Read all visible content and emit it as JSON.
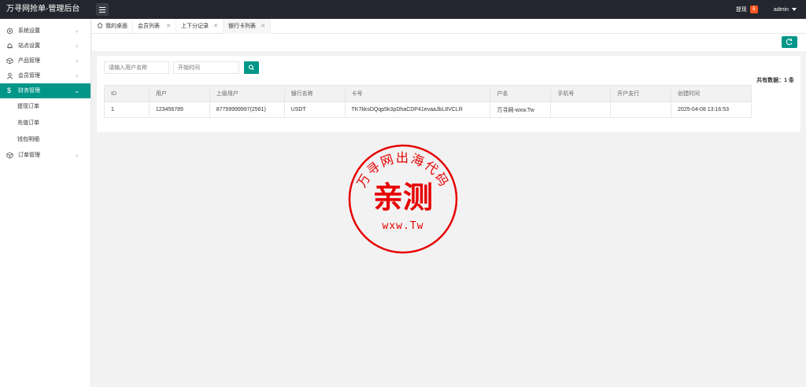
{
  "header": {
    "title": "万寻网抢单-管理后台",
    "withdraw_label": "提现",
    "withdraw_count": "6",
    "user": "admin"
  },
  "sidebar": {
    "items": [
      {
        "label": "系统设置",
        "icon": "gear-icon"
      },
      {
        "label": "站点设置",
        "icon": "bell-icon"
      },
      {
        "label": "产品管理",
        "icon": "box-icon"
      },
      {
        "label": "会员管理",
        "icon": "user-icon"
      },
      {
        "label": "财务管理",
        "icon": "dollar-icon"
      },
      {
        "label": "订单管理",
        "icon": "cube-icon"
      }
    ],
    "finance_sub": [
      "提现订单",
      "充值订单",
      "钱包明细"
    ]
  },
  "tabs": [
    {
      "label": "我的桌面"
    },
    {
      "label": "会员列表"
    },
    {
      "label": "上下分记录"
    },
    {
      "label": "银行卡列表"
    }
  ],
  "search": {
    "username_placeholder": "请输入用户名称",
    "start_time_placeholder": "开始时间"
  },
  "total_text": "共有数据：1 条",
  "table": {
    "columns": [
      "ID",
      "用户",
      "上级用户",
      "银行名称",
      "卡号",
      "户名",
      "手机号",
      "开户支行",
      "创建时间"
    ],
    "rows": [
      [
        "1",
        "123456789",
        "87799999997(2561)",
        "USDT",
        "TK7kksDQqp5k3pDhaCDP41evaaJbL8VCLR",
        "万寻网-wxw.Tw",
        "",
        "",
        "2025-04-08 13:16:53"
      ]
    ]
  },
  "stamp": {
    "arc_text": "万寻网出海代码",
    "main_text": "亲测",
    "bottom_text": "wxw.Tw",
    "color": "#e60000"
  },
  "colors": {
    "accent": "#009688",
    "header_bg": "#23262e",
    "badge": "#ff5722"
  }
}
